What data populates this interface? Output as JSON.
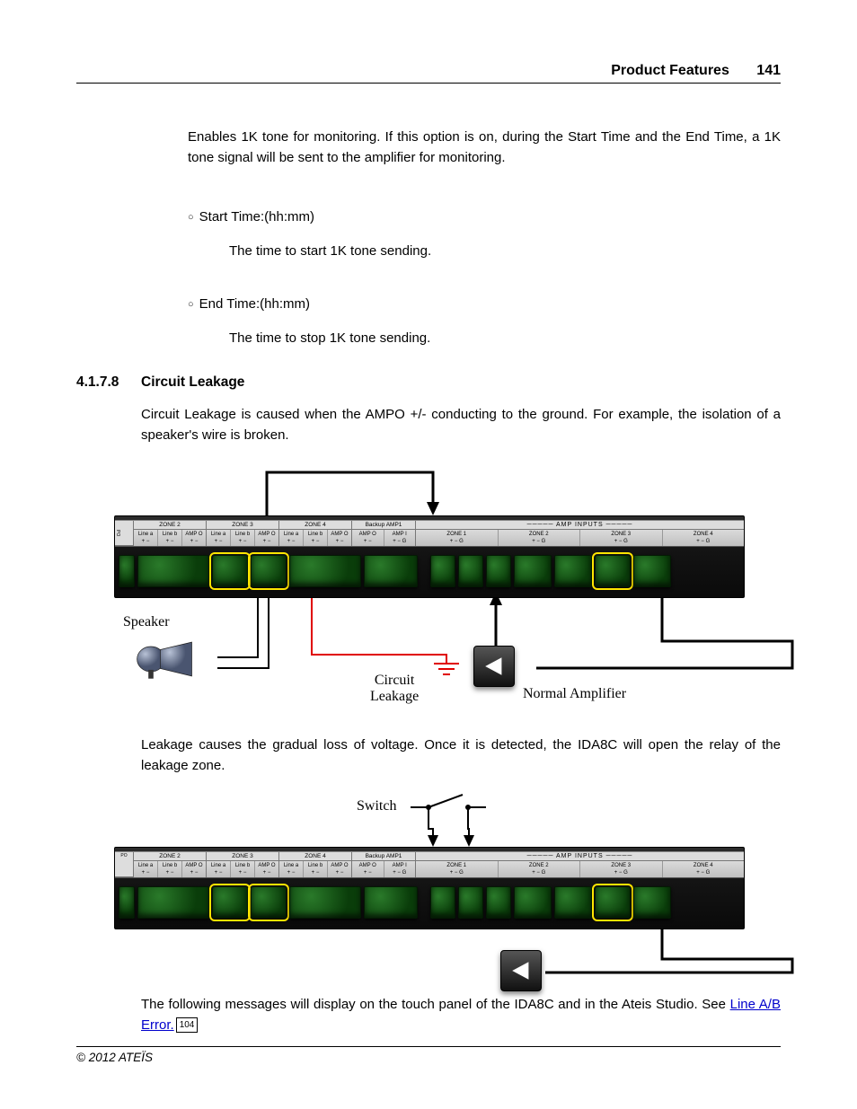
{
  "header": {
    "section": "Product Features",
    "page": "141"
  },
  "intro": {
    "tone_para": "Enables 1K tone for monitoring. If this option is on, during  the Start Time and the End Time, a 1K tone signal will be sent to the amplifier for monitoring.",
    "start_label": "Start Time:(hh:mm)",
    "start_desc": "The time to start 1K tone sending.",
    "end_label": "End Time:(hh:mm)",
    "end_desc": "The time to stop 1K tone sending."
  },
  "section": {
    "number": "4.1.7.8",
    "title": "Circuit Leakage",
    "para1": "Circuit Leakage is caused when the AMPO +/-  conducting to the ground. For example, the  isolation of a speaker's wire is broken.",
    "para2": "Leakage causes the gradual loss of voltage. Once it is detected, the IDA8C will open the relay of the leakage zone.",
    "para3_a": "The following messages will display on the touch panel of the IDA8C and in the Ateis Studio. See ",
    "link_text": "Line A/B Error.",
    "link_pageref": "104"
  },
  "diagram": {
    "zones": [
      "ZONE 2",
      "ZONE 3",
      "ZONE 4"
    ],
    "backup": "Backup AMP1",
    "amp_inputs_title": "AMP INPUTS",
    "amp_zones": [
      "ZONE 1",
      "ZONE 2",
      "ZONE 3",
      "ZONE 4"
    ],
    "sub_lines": [
      "Line a",
      "Line b",
      "AMP O"
    ],
    "sub_polarity": "+  −",
    "labels": {
      "speaker": "Speaker",
      "leakage": "Circuit\nLeakage",
      "normal_amp": "Normal Amplifier",
      "switch": "Switch"
    }
  },
  "footer": {
    "copyright": "© 2012 ATEÏS"
  }
}
